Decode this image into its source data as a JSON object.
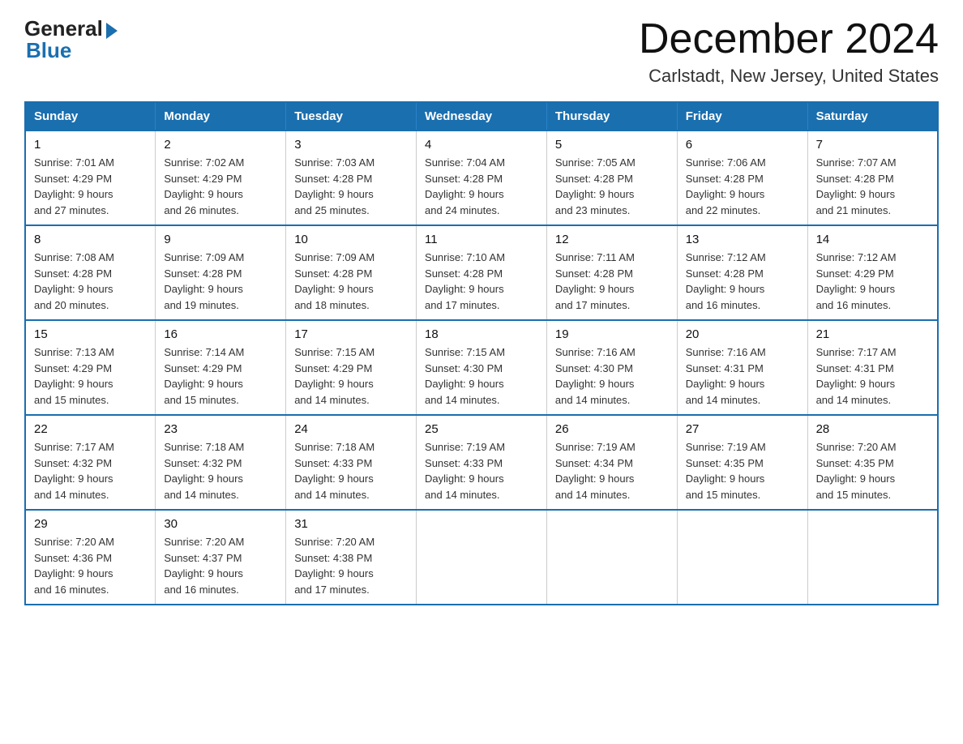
{
  "logo": {
    "general": "General",
    "blue": "Blue"
  },
  "title": "December 2024",
  "subtitle": "Carlstadt, New Jersey, United States",
  "header": {
    "accent_color": "#1a6faf",
    "days": [
      "Sunday",
      "Monday",
      "Tuesday",
      "Wednesday",
      "Thursday",
      "Friday",
      "Saturday"
    ]
  },
  "weeks": [
    [
      {
        "day": "1",
        "sunrise": "7:01 AM",
        "sunset": "4:29 PM",
        "daylight": "9 hours and 27 minutes."
      },
      {
        "day": "2",
        "sunrise": "7:02 AM",
        "sunset": "4:29 PM",
        "daylight": "9 hours and 26 minutes."
      },
      {
        "day": "3",
        "sunrise": "7:03 AM",
        "sunset": "4:28 PM",
        "daylight": "9 hours and 25 minutes."
      },
      {
        "day": "4",
        "sunrise": "7:04 AM",
        "sunset": "4:28 PM",
        "daylight": "9 hours and 24 minutes."
      },
      {
        "day": "5",
        "sunrise": "7:05 AM",
        "sunset": "4:28 PM",
        "daylight": "9 hours and 23 minutes."
      },
      {
        "day": "6",
        "sunrise": "7:06 AM",
        "sunset": "4:28 PM",
        "daylight": "9 hours and 22 minutes."
      },
      {
        "day": "7",
        "sunrise": "7:07 AM",
        "sunset": "4:28 PM",
        "daylight": "9 hours and 21 minutes."
      }
    ],
    [
      {
        "day": "8",
        "sunrise": "7:08 AM",
        "sunset": "4:28 PM",
        "daylight": "9 hours and 20 minutes."
      },
      {
        "day": "9",
        "sunrise": "7:09 AM",
        "sunset": "4:28 PM",
        "daylight": "9 hours and 19 minutes."
      },
      {
        "day": "10",
        "sunrise": "7:09 AM",
        "sunset": "4:28 PM",
        "daylight": "9 hours and 18 minutes."
      },
      {
        "day": "11",
        "sunrise": "7:10 AM",
        "sunset": "4:28 PM",
        "daylight": "9 hours and 17 minutes."
      },
      {
        "day": "12",
        "sunrise": "7:11 AM",
        "sunset": "4:28 PM",
        "daylight": "9 hours and 17 minutes."
      },
      {
        "day": "13",
        "sunrise": "7:12 AM",
        "sunset": "4:28 PM",
        "daylight": "9 hours and 16 minutes."
      },
      {
        "day": "14",
        "sunrise": "7:12 AM",
        "sunset": "4:29 PM",
        "daylight": "9 hours and 16 minutes."
      }
    ],
    [
      {
        "day": "15",
        "sunrise": "7:13 AM",
        "sunset": "4:29 PM",
        "daylight": "9 hours and 15 minutes."
      },
      {
        "day": "16",
        "sunrise": "7:14 AM",
        "sunset": "4:29 PM",
        "daylight": "9 hours and 15 minutes."
      },
      {
        "day": "17",
        "sunrise": "7:15 AM",
        "sunset": "4:29 PM",
        "daylight": "9 hours and 14 minutes."
      },
      {
        "day": "18",
        "sunrise": "7:15 AM",
        "sunset": "4:30 PM",
        "daylight": "9 hours and 14 minutes."
      },
      {
        "day": "19",
        "sunrise": "7:16 AM",
        "sunset": "4:30 PM",
        "daylight": "9 hours and 14 minutes."
      },
      {
        "day": "20",
        "sunrise": "7:16 AM",
        "sunset": "4:31 PM",
        "daylight": "9 hours and 14 minutes."
      },
      {
        "day": "21",
        "sunrise": "7:17 AM",
        "sunset": "4:31 PM",
        "daylight": "9 hours and 14 minutes."
      }
    ],
    [
      {
        "day": "22",
        "sunrise": "7:17 AM",
        "sunset": "4:32 PM",
        "daylight": "9 hours and 14 minutes."
      },
      {
        "day": "23",
        "sunrise": "7:18 AM",
        "sunset": "4:32 PM",
        "daylight": "9 hours and 14 minutes."
      },
      {
        "day": "24",
        "sunrise": "7:18 AM",
        "sunset": "4:33 PM",
        "daylight": "9 hours and 14 minutes."
      },
      {
        "day": "25",
        "sunrise": "7:19 AM",
        "sunset": "4:33 PM",
        "daylight": "9 hours and 14 minutes."
      },
      {
        "day": "26",
        "sunrise": "7:19 AM",
        "sunset": "4:34 PM",
        "daylight": "9 hours and 14 minutes."
      },
      {
        "day": "27",
        "sunrise": "7:19 AM",
        "sunset": "4:35 PM",
        "daylight": "9 hours and 15 minutes."
      },
      {
        "day": "28",
        "sunrise": "7:20 AM",
        "sunset": "4:35 PM",
        "daylight": "9 hours and 15 minutes."
      }
    ],
    [
      {
        "day": "29",
        "sunrise": "7:20 AM",
        "sunset": "4:36 PM",
        "daylight": "9 hours and 16 minutes."
      },
      {
        "day": "30",
        "sunrise": "7:20 AM",
        "sunset": "4:37 PM",
        "daylight": "9 hours and 16 minutes."
      },
      {
        "day": "31",
        "sunrise": "7:20 AM",
        "sunset": "4:38 PM",
        "daylight": "9 hours and 17 minutes."
      },
      null,
      null,
      null,
      null
    ]
  ],
  "labels": {
    "sunrise": "Sunrise:",
    "sunset": "Sunset:",
    "daylight": "Daylight:"
  }
}
